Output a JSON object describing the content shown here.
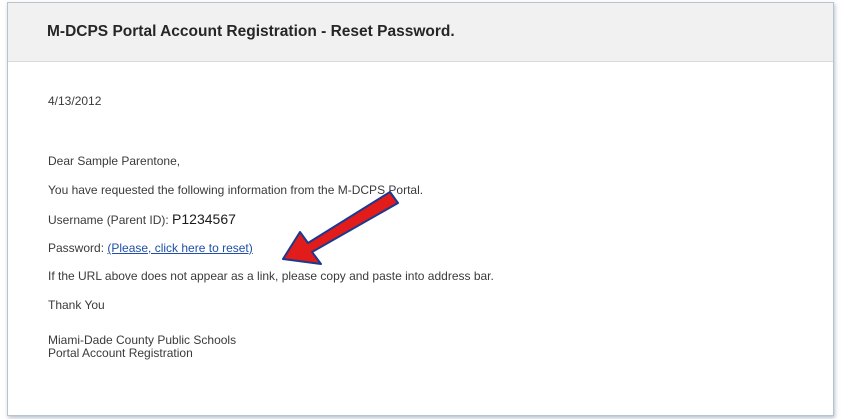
{
  "email": {
    "title": "M-DCPS Portal Account Registration - Reset Password.",
    "date": "4/13/2012",
    "greeting": "Dear Sample Parentone,",
    "intro": "You have requested the following information from the M-DCPS Portal.",
    "username_label": "Username (Parent ID): ",
    "username_value": "P1234567",
    "password_label": "Password: ",
    "reset_link_text": "(Please, click here to reset)",
    "url_note": "If the URL above does not appear as a link, please copy and paste into address bar.",
    "thanks": "Thank You",
    "signature_line1": "Miami-Dade County Public Schools",
    "signature_line2": "Portal Account Registration"
  },
  "colors": {
    "link": "#1f4fa8",
    "arrow_fill": "#e21b1b",
    "arrow_outline": "#1b3a8f",
    "header_bg": "#f1f1f1"
  }
}
